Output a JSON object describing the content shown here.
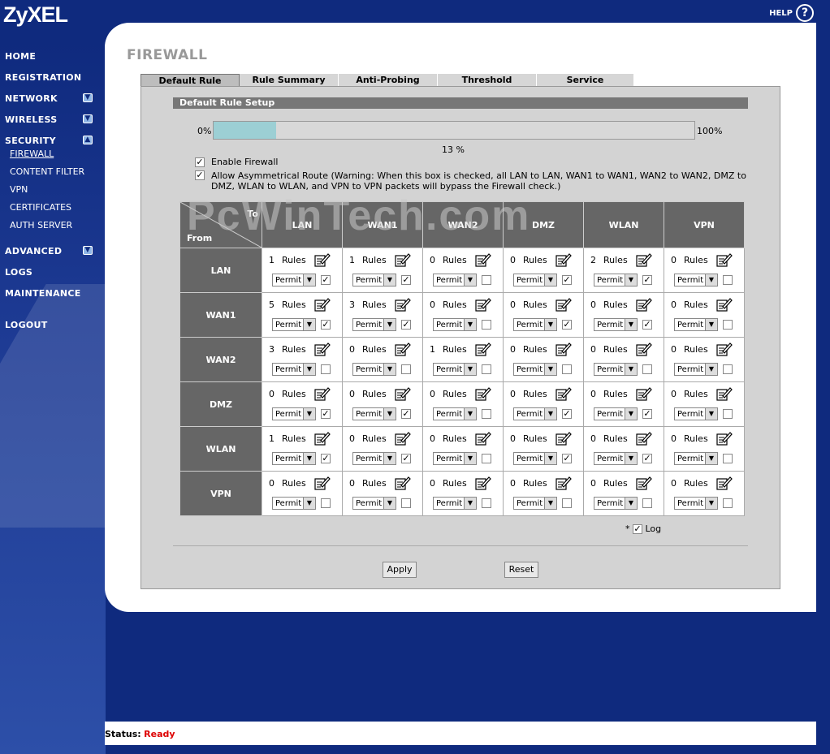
{
  "brand": "ZyXEL",
  "help_label": "HELP",
  "nav": {
    "home": "HOME",
    "registration": "REGISTRATION",
    "network": "NETWORK",
    "wireless": "WIRELESS",
    "security": "SECURITY",
    "advanced": "ADVANCED",
    "logs": "LOGS",
    "maintenance": "MAINTENANCE",
    "logout": "LOGOUT"
  },
  "security_sub": [
    "FIREWALL",
    "CONTENT FILTER",
    "VPN",
    "CERTIFICATES",
    "AUTH SERVER"
  ],
  "page_title": "FIREWALL",
  "tabs": [
    "Default Rule",
    "Rule Summary",
    "Anti-Probing",
    "Threshold",
    "Service"
  ],
  "section_title": "Default Rule Setup",
  "progress": {
    "min_label": "0%",
    "max_label": "100%",
    "value_label": "13 %",
    "value": 13
  },
  "enable_firewall": {
    "label": "Enable Firewall",
    "checked": true
  },
  "asym_route": {
    "label": "Allow Asymmetrical Route (Warning: When this box is checked, all LAN to LAN, WAN1 to WAN1, WAN2 to WAN2, DMZ to DMZ, WLAN to WLAN, and VPN to VPN packets will bypass the Firewall check.)",
    "checked": true
  },
  "matrix": {
    "to_label": "To",
    "from_label": "From",
    "rules_label": "Rules",
    "action_label": "Permit",
    "columns": [
      "LAN",
      "WAN1",
      "WAN2",
      "DMZ",
      "WLAN",
      "VPN"
    ],
    "rows": [
      {
        "name": "LAN",
        "rules": [
          1,
          1,
          0,
          0,
          2,
          0
        ],
        "log": [
          true,
          true,
          false,
          true,
          true,
          false
        ]
      },
      {
        "name": "WAN1",
        "rules": [
          5,
          3,
          0,
          0,
          0,
          0
        ],
        "log": [
          true,
          true,
          false,
          true,
          true,
          false
        ]
      },
      {
        "name": "WAN2",
        "rules": [
          3,
          0,
          1,
          0,
          0,
          0
        ],
        "log": [
          false,
          false,
          false,
          false,
          false,
          false
        ]
      },
      {
        "name": "DMZ",
        "rules": [
          0,
          0,
          0,
          0,
          0,
          0
        ],
        "log": [
          true,
          true,
          false,
          true,
          true,
          false
        ]
      },
      {
        "name": "WLAN",
        "rules": [
          1,
          0,
          0,
          0,
          0,
          0
        ],
        "log": [
          true,
          true,
          false,
          true,
          true,
          false
        ]
      },
      {
        "name": "VPN",
        "rules": [
          0,
          0,
          0,
          0,
          0,
          0
        ],
        "log": [
          false,
          false,
          false,
          false,
          false,
          false
        ]
      }
    ]
  },
  "log_legend": {
    "prefix": "*",
    "label": "Log",
    "checked": true
  },
  "buttons": {
    "apply": "Apply",
    "reset": "Reset"
  },
  "status": {
    "label": "Status:",
    "value": "Ready"
  },
  "watermark": "PcWinTech.com"
}
